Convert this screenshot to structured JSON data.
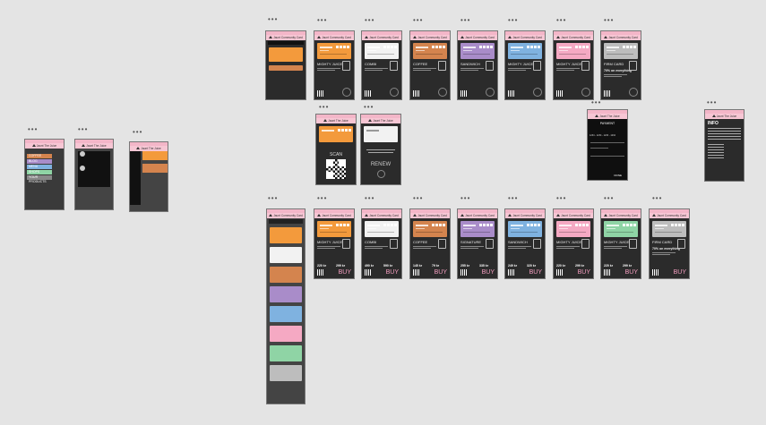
{
  "header": {
    "title": "Jaunt Community Card",
    "title_short": "Jaunt The Juice"
  },
  "row1": [
    {
      "label": "MIGHTY JUICE",
      "color": "#f39a3c"
    },
    {
      "label": "COMBI",
      "color": "#f2f2f2"
    },
    {
      "label": "COFFEE",
      "color": "#d4844e"
    },
    {
      "label": "SANDWICH",
      "color": "#a98cc9"
    },
    {
      "label": "MIGHTY JUICE",
      "color": "#7fb2e0"
    },
    {
      "label": "MIGHTY JUICE",
      "color": "#f5a9c3"
    },
    {
      "label": "FIRM CARD",
      "color": "#bdbdbd",
      "extra": "70% on everything"
    }
  ],
  "row3": [
    {
      "label": "MIGHTY JUICE",
      "color": "#f39a3c",
      "price": "220 kr",
      "reg": "299 kr"
    },
    {
      "label": "COMBI",
      "color": "#f2f2f2",
      "price": "490 kr",
      "reg": "590 kr"
    },
    {
      "label": "COFFEE",
      "color": "#d4844e",
      "price": "145 kr",
      "reg": "79 kr"
    },
    {
      "label": "SIGNATURE",
      "color": "#a98cc9",
      "price": "255 kr",
      "reg": "335 kr"
    },
    {
      "label": "SANDWICH",
      "color": "#7fb2e0",
      "price": "249 kr",
      "reg": "320 kr"
    },
    {
      "label": "MIGHTY JUICE",
      "color": "#f5a9c3",
      "price": "220 kr",
      "reg": "299 kr"
    },
    {
      "label": "MIGHTY JUICE",
      "color": "#8fd4a5",
      "price": "220 kr",
      "reg": "299 kr"
    },
    {
      "label": "FIRM CARD",
      "color": "#bdbdbd",
      "extra": "70% on everything"
    }
  ],
  "buy_label": "BUY",
  "scan": {
    "label": "SCAN"
  },
  "renew": {
    "label": "RENEW"
  },
  "payment": {
    "title": "PAYMENT",
    "number": "1234 - 1234 - 1234 - 1234",
    "button": "DONE"
  },
  "info": {
    "title": "INFO"
  },
  "menu": {
    "items": [
      "COFFEE",
      "BLOG",
      "MENU",
      "SHOPS",
      "YOUR PRODUCTS"
    ]
  },
  "colors": {
    "pink": "#f7c6d4",
    "buy": "#f59ec0"
  }
}
